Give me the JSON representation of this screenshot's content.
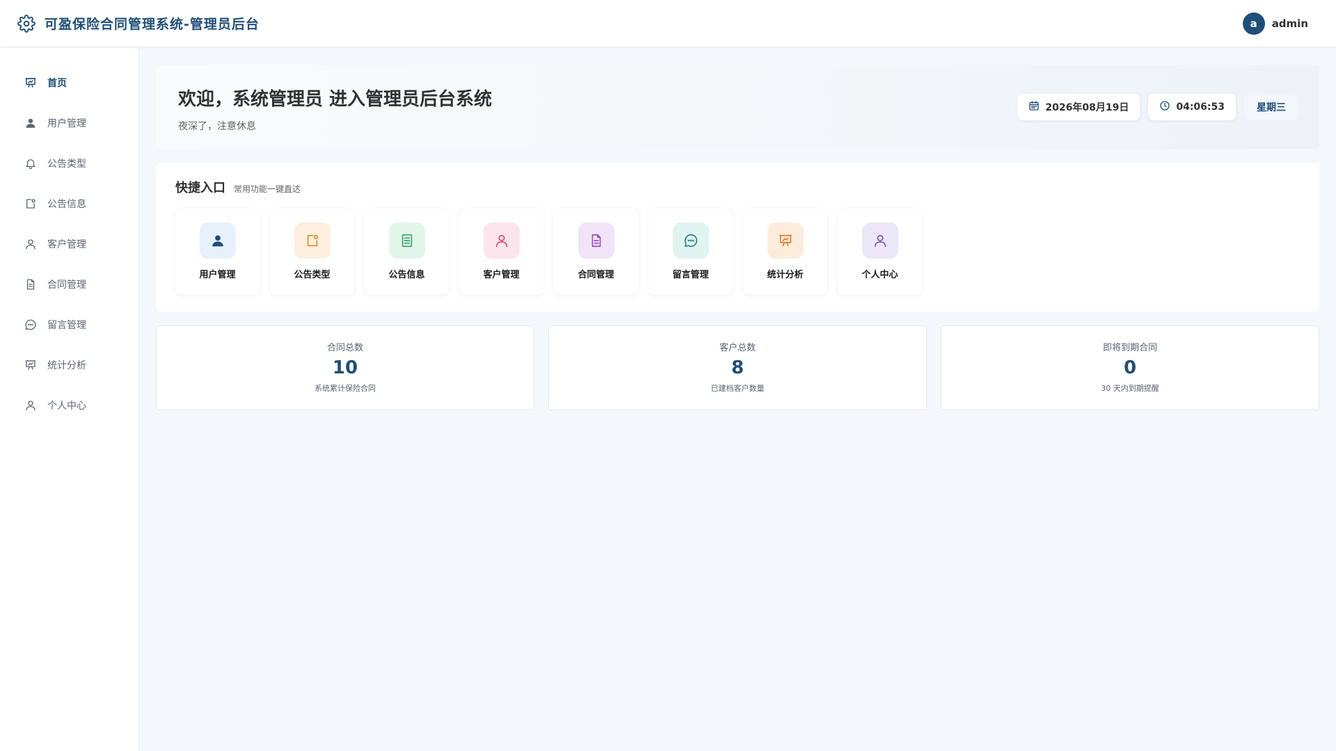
{
  "header": {
    "title": "可盈保险合同管理系统-管理员后台",
    "logo_icon": "gear-icon",
    "avatar_letter": "a",
    "username": "admin"
  },
  "sidebar": {
    "items": [
      {
        "label": "首页",
        "icon": "presentation-chart-icon",
        "active": true
      },
      {
        "label": "用户管理",
        "icon": "user-solid-icon"
      },
      {
        "label": "公告类型",
        "icon": "bell-icon"
      },
      {
        "label": "公告信息",
        "icon": "notice-icon"
      },
      {
        "label": "客户管理",
        "icon": "user-icon"
      },
      {
        "label": "合同管理",
        "icon": "document-icon"
      },
      {
        "label": "留言管理",
        "icon": "chat-icon"
      },
      {
        "label": "统计分析",
        "icon": "presentation-chart-icon"
      },
      {
        "label": "个人中心",
        "icon": "user-icon"
      }
    ]
  },
  "welcome": {
    "title": "欢迎，系统管理员 进入管理员后台系统",
    "subtitle": "夜深了，注意休息",
    "date": "2026年08月19日",
    "time": "04:06:53",
    "weekday": "星期三"
  },
  "quick": {
    "title": "快捷入口",
    "subtitle": "常用功能一键直达",
    "items": [
      {
        "label": "用户管理",
        "icon": "user-solid-icon",
        "bg": "#e6f1fb",
        "color": "#1f4e7a"
      },
      {
        "label": "公告类型",
        "icon": "notice-icon",
        "bg": "#fdeedd",
        "color": "#e08a2c"
      },
      {
        "label": "公告信息",
        "icon": "list-document-icon",
        "bg": "#e3f5ea",
        "color": "#3aa76d"
      },
      {
        "label": "客户管理",
        "icon": "user-icon",
        "bg": "#fce4ec",
        "color": "#d8456b"
      },
      {
        "label": "合同管理",
        "icon": "document-icon",
        "bg": "#f1e4f7",
        "color": "#9b4dbf"
      },
      {
        "label": "留言管理",
        "icon": "chat-icon",
        "bg": "#e0f3f1",
        "color": "#23877a"
      },
      {
        "label": "统计分析",
        "icon": "presentation-chart-icon",
        "bg": "#fdecdc",
        "color": "#e07a2a"
      },
      {
        "label": "个人中心",
        "icon": "user-icon",
        "bg": "#ece6f6",
        "color": "#7a55b8"
      }
    ]
  },
  "stats": [
    {
      "title": "合同总数",
      "value": "10",
      "note": "系统累计保险合同"
    },
    {
      "title": "客户总数",
      "value": "8",
      "note": "已建档客户数量"
    },
    {
      "title": "即将到期合同",
      "value": "0",
      "note": "30 天内到期提醒"
    }
  ],
  "colors": {
    "primary": "#1f4e7a",
    "background": "#f4f7fb",
    "nav_icon": "#5a6473"
  }
}
